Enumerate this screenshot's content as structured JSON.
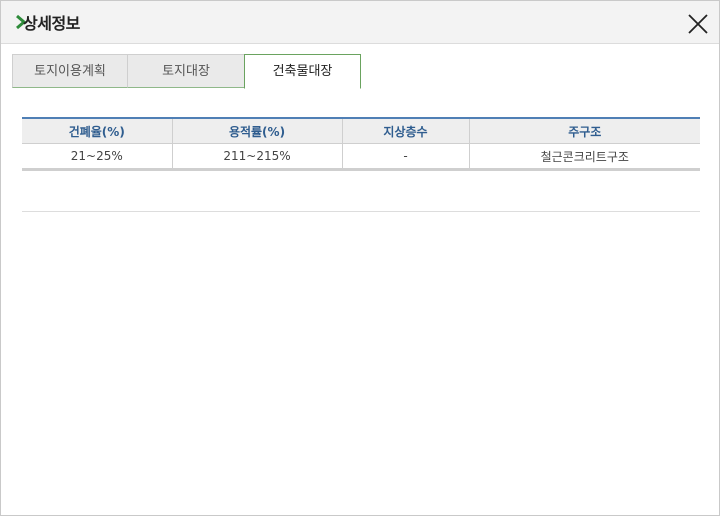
{
  "dialog": {
    "title": "상세정보",
    "accent_color": "#2e8b3a"
  },
  "tabs": [
    {
      "label": "토지이용계획",
      "active": false
    },
    {
      "label": "토지대장",
      "active": false
    },
    {
      "label": "건축물대장",
      "active": true
    }
  ],
  "table": {
    "headers": [
      "건폐율(%)",
      "용적률(%)",
      "지상층수",
      "주구조"
    ],
    "rows": [
      [
        "21~25%",
        "211~215%",
        "-",
        "철근콘크리트구조"
      ]
    ]
  }
}
